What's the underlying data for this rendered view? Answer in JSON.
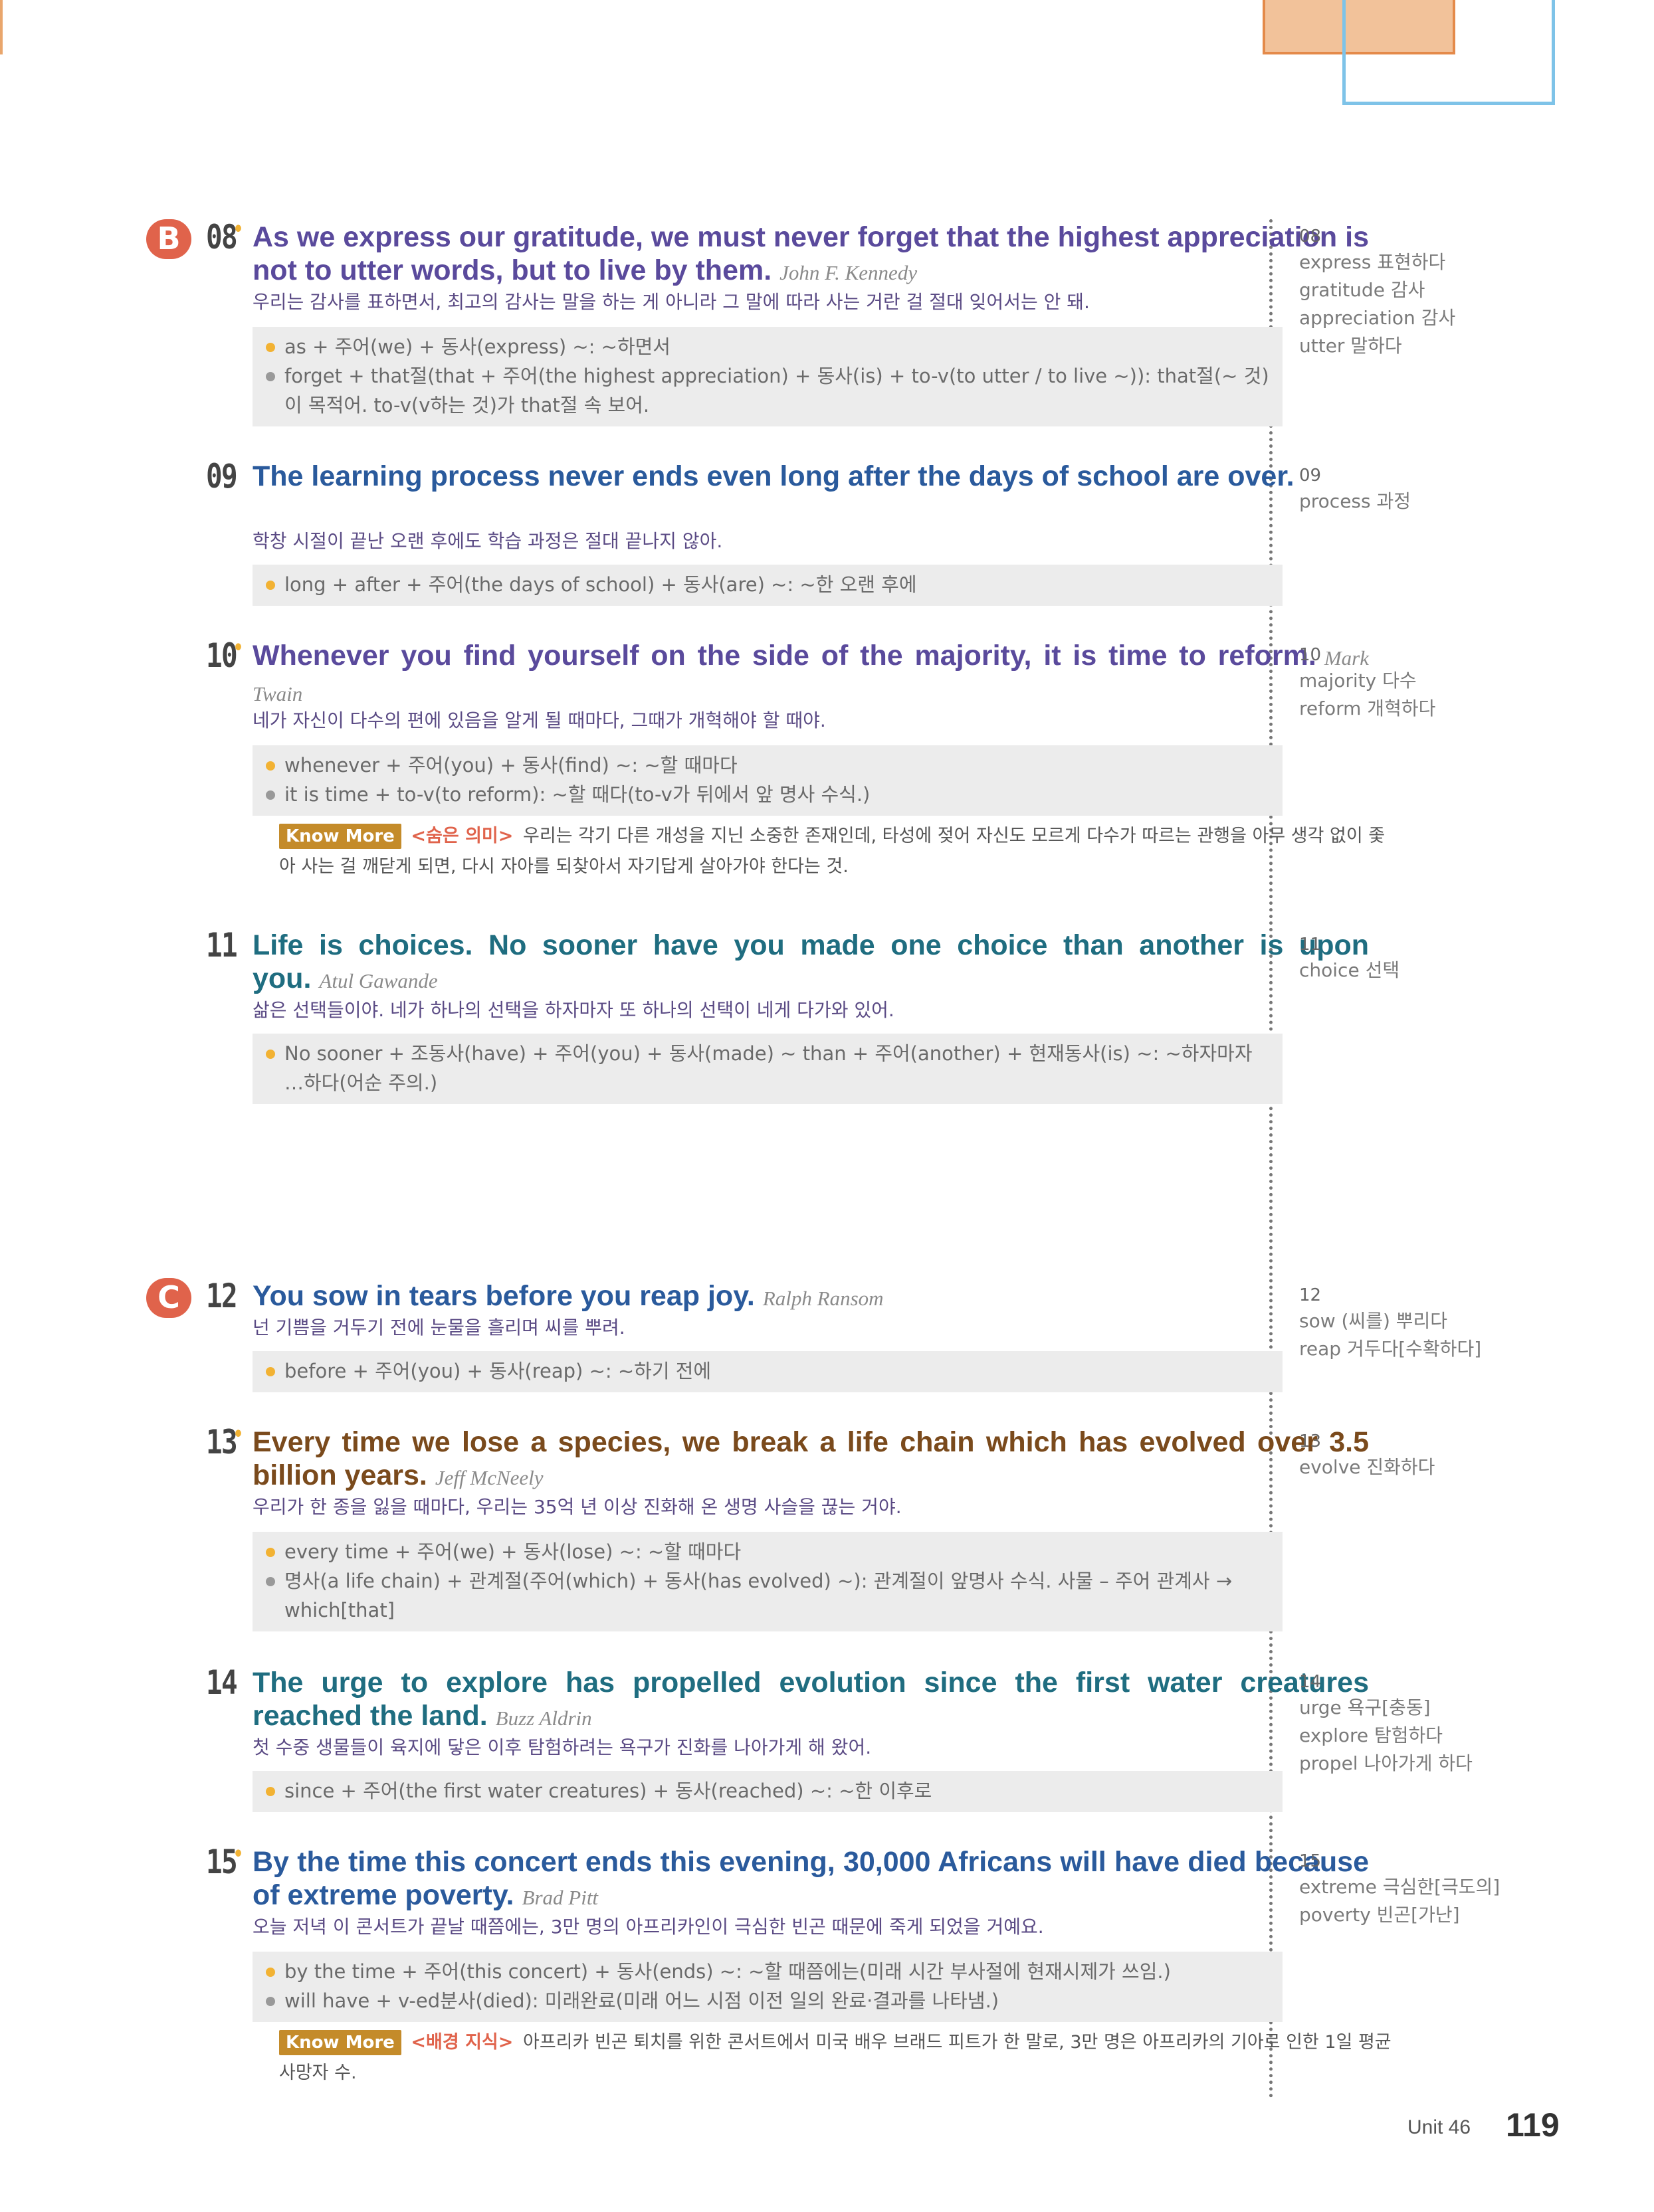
{
  "sections": [
    {
      "label": "B",
      "first_item": "08"
    },
    {
      "label": "C",
      "first_item": "12"
    }
  ],
  "items": [
    {
      "num": "08",
      "english": "As we express our gratitude, we must never forget that the highest appreciation is not to utter words, but to live by them.",
      "author": "John F. Kennedy",
      "korean": "우리는 감사를 표하면서, 최고의 감사는 말을 하는 게 아니라 그 말에 따라 사는 거란 걸 절대 잊어서는 안 돼.",
      "notes": [
        "as + 주어(we) + 동사(express) ~: ~하면서",
        "forget + that절(that + 주어(the highest appreciation) + 동사(is) + to-v(to utter / to live ~)): that절(~ 것)이 목적어. to-v(v하는 것)가 that절 속 보어."
      ],
      "vocab": [
        "express 표현하다",
        "gratitude 감사",
        "appreciation 감사",
        "utter 말하다"
      ]
    },
    {
      "num": "09",
      "english": "The learning process never ends even long after the days of school are over.",
      "author": "",
      "korean": "학창 시절이 끝난 오랜 후에도 학습 과정은 절대 끝나지 않아.",
      "notes": [
        "long + after + 주어(the days of school) + 동사(are) ~: ~한 오랜 후에"
      ],
      "vocab": [
        "process 과정"
      ]
    },
    {
      "num": "10",
      "english": "Whenever you find yourself on the side of the majority, it is time to reform.",
      "author": "Mark Twain",
      "korean": "네가 자신이 다수의 편에 있음을 알게 될 때마다, 그때가 개혁해야 할 때야.",
      "notes": [
        "whenever + 주어(you) + 동사(find) ~: ~할 때마다",
        "it is time + to-v(to reform): ~할 때다(to-v가 뒤에서 앞 명사 수식.)"
      ],
      "know_more": {
        "tag": "Know More",
        "head": "<숨은 의미>",
        "text": "우리는 각기 다른 개성을 지닌 소중한 존재인데, 타성에 젖어 자신도 모르게 다수가 따르는 관행을 아무 생각 없이 좇아 사는 걸 깨닫게 되면, 다시 자아를 되찾아서 자기답게 살아가야 한다는 것."
      },
      "vocab": [
        "majority 다수",
        "reform 개혁하다"
      ]
    },
    {
      "num": "11",
      "english": "Life is choices. No sooner have you made one choice than another is upon you.",
      "author": "Atul Gawande",
      "korean": "삶은 선택들이야. 네가 하나의 선택을 하자마자 또 하나의 선택이 네게 다가와 있어.",
      "notes": [
        "No sooner + 조동사(have) + 주어(you) + 동사(made) ~ than + 주어(another) + 현재동사(is) ~: ~하자마자 …하다(어순 주의.)"
      ],
      "vocab": [
        "choice 선택"
      ]
    },
    {
      "num": "12",
      "english": "You sow in tears before you reap joy.",
      "author": "Ralph Ransom",
      "korean": "넌 기쁨을 거두기 전에 눈물을 흘리며 씨를 뿌려.",
      "notes": [
        "before + 주어(you) + 동사(reap) ~: ~하기 전에"
      ],
      "vocab": [
        "sow (씨를) 뿌리다",
        "reap 거두다[수확하다]"
      ]
    },
    {
      "num": "13",
      "english": "Every time we lose a species, we break a life chain which has evolved over 3.5 billion years.",
      "author": "Jeff McNeely",
      "korean": "우리가 한 종을 잃을 때마다, 우리는 35억 년 이상 진화해 온 생명 사슬을 끊는 거야.",
      "notes": [
        "every time + 주어(we) + 동사(lose) ~: ~할 때마다",
        "명사(a life chain) + 관계절(주어(which) + 동사(has evolved) ~): 관계절이 앞명사 수식. 사물 – 주어 관계사 → which[that]"
      ],
      "vocab": [
        "evolve 진화하다"
      ]
    },
    {
      "num": "14",
      "english": "The urge to explore has propelled evolution since the first water creatures reached the land.",
      "author": "Buzz Aldrin",
      "korean": "첫 수중 생물들이 육지에 닿은 이후 탐험하려는 욕구가 진화를 나아가게 해 왔어.",
      "notes": [
        "since + 주어(the first water creatures) + 동사(reached) ~: ~한 이후로"
      ],
      "vocab": [
        "urge 욕구[충동]",
        "explore 탐험하다",
        "propel 나아가게 하다"
      ]
    },
    {
      "num": "15",
      "english": "By the time this concert ends this evening, 30,000 Africans will have died because of extreme poverty.",
      "author": "Brad Pitt",
      "korean": "오늘 저녁 이 콘서트가 끝날 때쯤에는, 3만 명의 아프리카인이 극심한 빈곤 때문에 죽게 되었을 거예요.",
      "notes": [
        "by the time + 주어(this concert) + 동사(ends) ~: ~할 때쯤에는(미래 시간 부사절에 현재시제가 쓰임.)",
        "will have + v-ed분사(died): 미래완료(미래 어느 시점 이전 일의 완료·결과를 나타냄.)"
      ],
      "know_more": {
        "tag": "Know More",
        "head": "<배경 지식>",
        "text": "아프리카 빈곤 퇴치를 위한 콘서트에서 미국 배우 브래드 피트가 한 말로, 3만 명은 아프리카의 기아로 인한 1일 평균 사망자 수."
      },
      "vocab": [
        "extreme 극심한[극도의]",
        "poverty 빈곤[가난]"
      ]
    }
  ],
  "footer": {
    "unit": "Unit 46",
    "page": "119"
  }
}
